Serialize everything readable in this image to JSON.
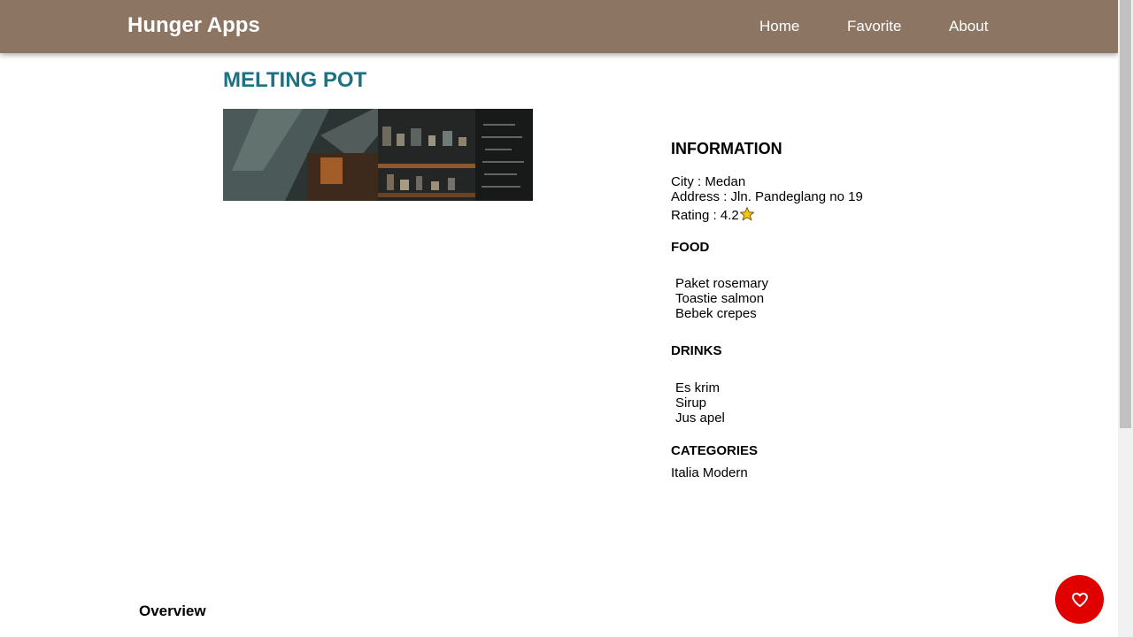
{
  "header": {
    "brand": "Hunger Apps",
    "nav": [
      "Home",
      "Favorite",
      "About"
    ]
  },
  "restaurant": {
    "name": "MELTING POT",
    "info_heading": "INFORMATION",
    "city": "City : Medan",
    "address": "Address : Jln. Pandeglang no 19",
    "rating": "Rating : 4.2",
    "food_heading": "FOOD",
    "foods": [
      "Paket rosemary",
      "Toastie salmon",
      "Bebek crepes"
    ],
    "drinks_heading": "DRINKS",
    "drinks": [
      "Es krim",
      "Sirup",
      "Jus apel"
    ],
    "categories_heading": "CATEGORIES",
    "categories": "Italia Modern"
  },
  "overview_heading": "Overview",
  "icons": {
    "rating": "star-icon",
    "favorite": "heart-icon"
  },
  "colors": {
    "header_bg": "#8c7663",
    "title": "#1a7283",
    "favorite_button": "#e00000",
    "star": "#f5c518"
  }
}
